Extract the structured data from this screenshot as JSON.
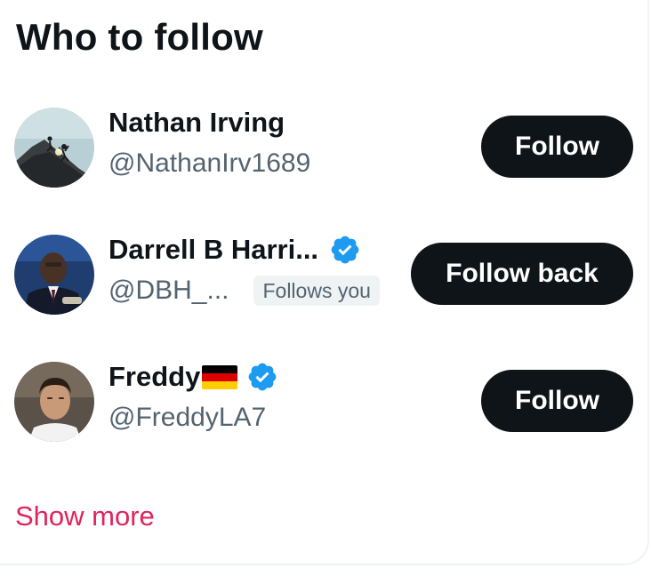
{
  "panel": {
    "title": "Who to follow",
    "show_more_label": "Show more",
    "accent_color": "#e0245e",
    "verified_color": "#1d9bf0"
  },
  "suggestions": [
    {
      "name": "Nathan Irving",
      "handle": "@NathanIrv1689",
      "verified": false,
      "follows_you": false,
      "button_label": "Follow"
    },
    {
      "name": "Darrell B Harri...",
      "handle": "@DBH_...",
      "verified": true,
      "follows_you": true,
      "follows_you_label": "Follows you",
      "button_label": "Follow back"
    },
    {
      "name": "Freddy",
      "flag_icon": "germany-flag-icon",
      "handle": "@FreddyLA7",
      "verified": true,
      "follows_you": false,
      "button_label": "Follow"
    }
  ]
}
